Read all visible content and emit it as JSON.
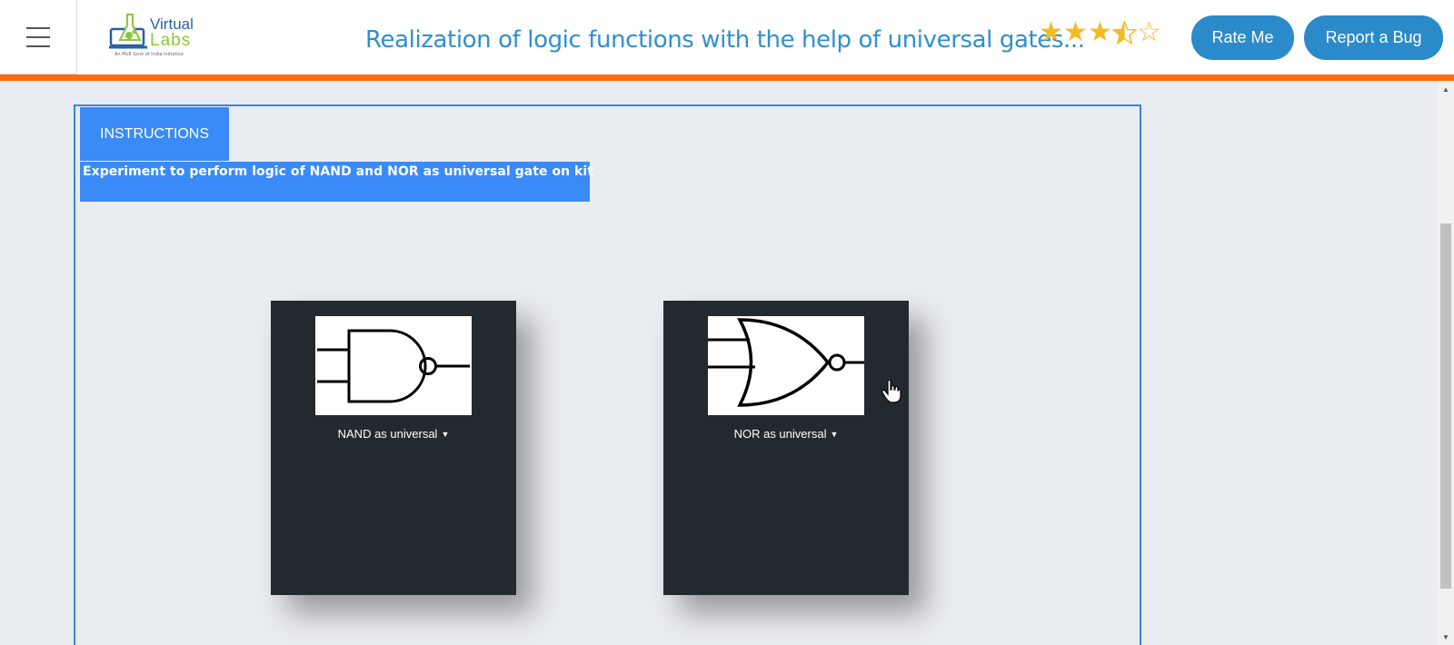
{
  "header": {
    "logo": {
      "line1": "Virtual",
      "line2": "Labs",
      "tagline": "An MoE Govt of India Initiative"
    },
    "title": "Realization of logic functions with the help of universal gates...",
    "rating": {
      "value": 3.5,
      "max": 5
    },
    "rate_button": "Rate Me",
    "bug_button": "Report a Bug"
  },
  "colors": {
    "accent_orange": "#ff6b0a",
    "title_blue": "#2f8fcf",
    "button_blue": "#2b8ac9",
    "tab_blue": "#3a8af7",
    "card_bg": "#232a2f"
  },
  "content": {
    "tab_label": "INSTRUCTIONS",
    "experiment_text": "Experiment to perform logic of NAND and NOR as universal gate on kit",
    "cards": [
      {
        "label": "NAND as universal",
        "icon": "nand-gate-icon"
      },
      {
        "label": "NOR as universal",
        "icon": "nor-gate-icon"
      }
    ]
  }
}
